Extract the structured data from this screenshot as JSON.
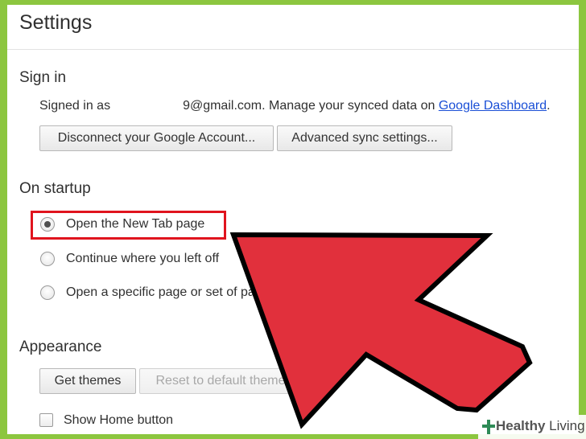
{
  "header": {
    "title": "Settings"
  },
  "sign_in": {
    "heading": "Sign in",
    "signed_prefix": "Signed in as",
    "signed_email_tail": "9@gmail.com.",
    "signed_manage_text": "Manage your synced data on",
    "dashboard_link": "Google Dashboard",
    "period": ".",
    "disconnect_button": "Disconnect your Google Account...",
    "advanced_sync_button": "Advanced sync settings..."
  },
  "startup": {
    "heading": "On startup",
    "options": [
      {
        "label": "Open the New Tab page",
        "selected": true
      },
      {
        "label": "Continue where you left off",
        "selected": false
      },
      {
        "label": "Open a specific page or set of pages.",
        "selected": false
      }
    ]
  },
  "appearance": {
    "heading": "Appearance",
    "get_themes_button": "Get themes",
    "reset_theme_button": "Reset to default theme",
    "show_home_label": "Show Home button",
    "show_home_checked": false
  },
  "watermark": {
    "brand_bold": "Healthy",
    "brand_rest": " Living"
  },
  "colors": {
    "page_bg": "#8cc63f",
    "highlight": "#e0141e",
    "arrow_fill": "#e1303c",
    "link": "#1a4fd6"
  }
}
